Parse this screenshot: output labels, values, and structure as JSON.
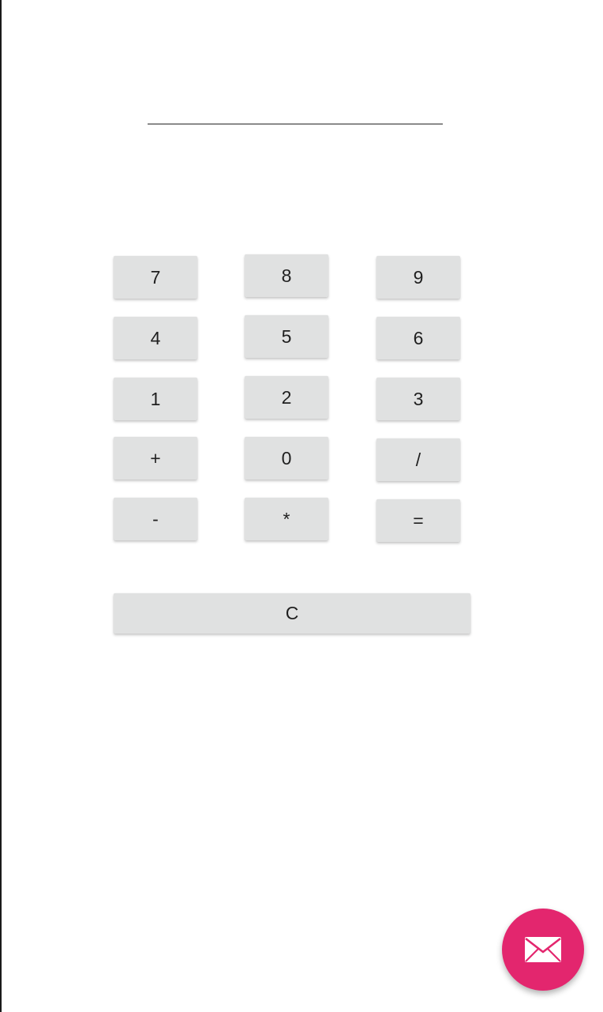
{
  "display": {
    "value": "",
    "placeholder": ""
  },
  "keypad": {
    "rows": [
      [
        "7",
        "8",
        "9"
      ],
      [
        "4",
        "5",
        "6"
      ],
      [
        "1",
        "2",
        "3"
      ],
      [
        "+",
        "0",
        "/"
      ],
      [
        "-",
        "*",
        "="
      ]
    ],
    "clear_label": "C"
  },
  "fab": {
    "icon": "mail-icon",
    "color": "#e3266e"
  }
}
